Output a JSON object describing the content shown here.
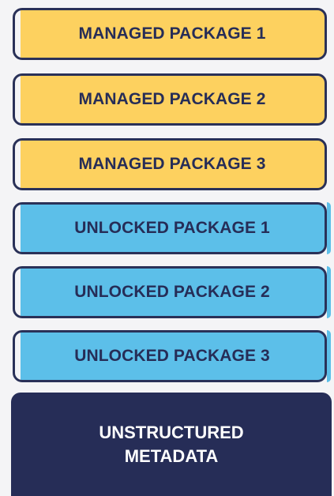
{
  "layers": {
    "managed": [
      {
        "label": "MANAGED PACKAGE 1"
      },
      {
        "label": "MANAGED PACKAGE 2"
      },
      {
        "label": "MANAGED PACKAGE 3"
      }
    ],
    "unlocked": [
      {
        "label": "UNLOCKED PACKAGE 1"
      },
      {
        "label": "UNLOCKED PACKAGE 2"
      },
      {
        "label": "UNLOCKED PACKAGE 3"
      }
    ],
    "base": {
      "label": "UNSTRUCTURED METADATA"
    }
  },
  "colors": {
    "managed_fill": "#fdd15f",
    "unlocked_fill": "#5cbfe9",
    "base_fill": "#262d57",
    "border": "#2a3158"
  }
}
